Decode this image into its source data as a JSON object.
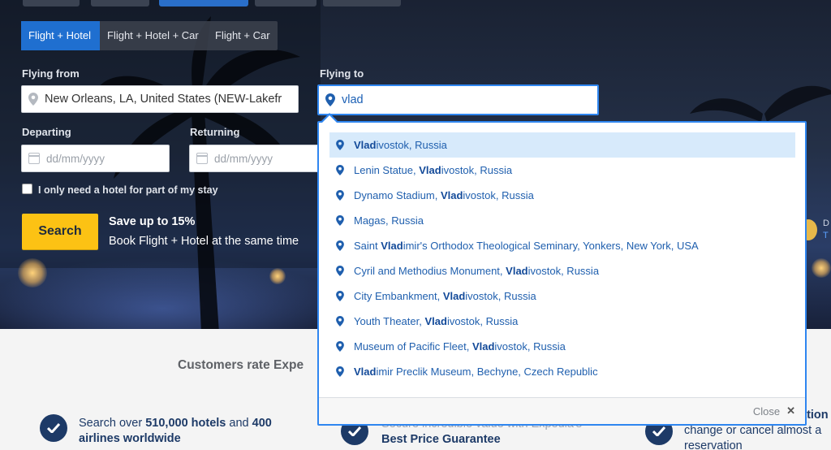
{
  "tabs_sub": [
    {
      "label": "Flight + Hotel",
      "active": true
    },
    {
      "label": "Flight + Hotel + Car",
      "active": false
    },
    {
      "label": "Flight + Car",
      "active": false
    }
  ],
  "form": {
    "flying_from_label": "Flying from",
    "flying_from_value": "New Orleans, LA, United States (NEW-Lakefr",
    "flying_to_label": "Flying to",
    "flying_to_value": "vlad",
    "departing_label": "Departing",
    "departing_placeholder": "dd/mm/yyyy",
    "returning_label": "Returning",
    "returning_placeholder": "dd/mm/yyyy",
    "hotel_partial_label": "I only need a hotel for part of my stay",
    "search_label": "Search"
  },
  "promo": {
    "title": "Save up to 15%",
    "subtitle": "Book Flight + Hotel at the same time"
  },
  "right_edge": {
    "line1": "D",
    "line2": "T"
  },
  "suggestions": [
    {
      "bold": "Vlad",
      "rest": "ivostok, Russia",
      "prefix": "",
      "highlighted": true
    },
    {
      "prefix": "Lenin Statue, ",
      "bold": "Vlad",
      "rest": "ivostok, Russia",
      "highlighted": false
    },
    {
      "prefix": "Dynamo Stadium, ",
      "bold": "Vlad",
      "rest": "ivostok, Russia",
      "highlighted": false
    },
    {
      "prefix": "Magas, Russia",
      "bold": "",
      "rest": "",
      "highlighted": false
    },
    {
      "prefix": "Saint ",
      "bold": "Vlad",
      "rest": "imir's Orthodox Theological Seminary, Yonkers, New York, USA",
      "highlighted": false
    },
    {
      "prefix": "Cyril and Methodius Monument, ",
      "bold": "Vlad",
      "rest": "ivostok, Russia",
      "highlighted": false
    },
    {
      "prefix": "City Embankment, ",
      "bold": "Vlad",
      "rest": "ivostok, Russia",
      "highlighted": false
    },
    {
      "prefix": "Youth Theater, ",
      "bold": "Vlad",
      "rest": "ivostok, Russia",
      "highlighted": false
    },
    {
      "prefix": "Museum of Pacific Fleet, ",
      "bold": "Vlad",
      "rest": "ivostok, Russia",
      "highlighted": false
    },
    {
      "prefix": "",
      "bold": "Vlad",
      "rest": "imir Preclik Museum, Bechyne, Czech Republic",
      "highlighted": false
    }
  ],
  "dropdown_close": "Close",
  "bottom": {
    "rate_title": "Customers rate Expe",
    "feature1_pre": "Search over ",
    "feature1_b1": "510,000 hotels",
    "feature1_mid": " and ",
    "feature1_b2": "400",
    "feature1_line2": "airlines worldwide",
    "feature2_line1": "Secure incredible value with Expedia's",
    "feature2_line2": "Best Price Guarantee",
    "feature3_line0": "ation",
    "feature3_line1": "change or cancel almost a",
    "feature3_line2": "reservation"
  },
  "colors": {
    "accent": "#1f6fd0",
    "search_button": "#fcc214",
    "suggestion_text": "#1f5fae",
    "suggestion_highlight": "#d7eafb"
  }
}
